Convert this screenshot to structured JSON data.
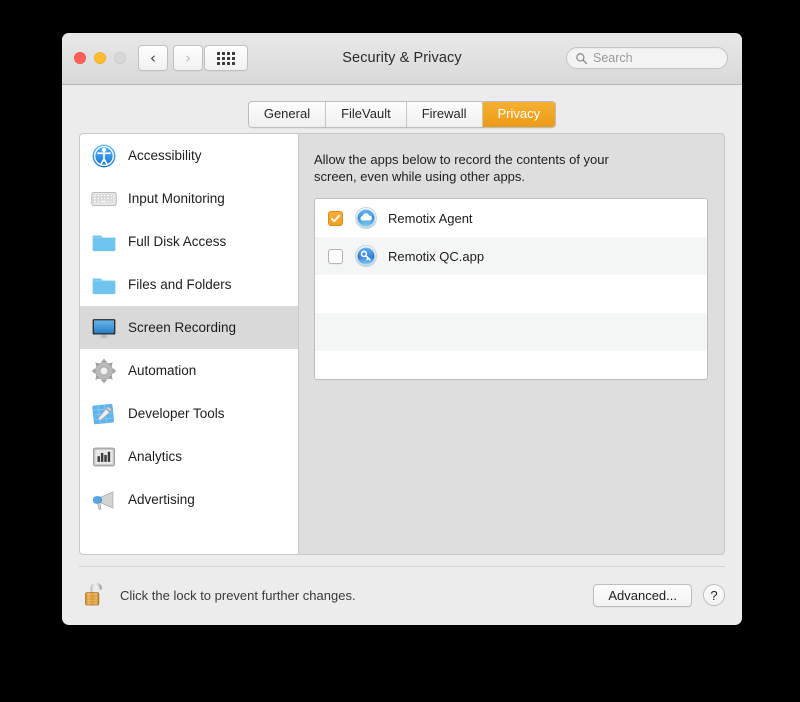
{
  "window": {
    "title": "Security & Privacy",
    "traffic_lights": [
      "close",
      "minimize",
      "zoom"
    ],
    "nav": {
      "back": "back-arrow",
      "forward": "forward-arrow",
      "grid": "show-all-grid"
    },
    "search": {
      "placeholder": "Search",
      "value": "",
      "icon": "search-icon"
    }
  },
  "tabs": [
    {
      "label": "General",
      "active": false
    },
    {
      "label": "FileVault",
      "active": false
    },
    {
      "label": "Firewall",
      "active": false
    },
    {
      "label": "Privacy",
      "active": true
    }
  ],
  "sidebar": {
    "items": [
      {
        "label": "Accessibility",
        "icon": "accessibility-icon",
        "selected": false
      },
      {
        "label": "Input Monitoring",
        "icon": "keyboard-icon",
        "selected": false
      },
      {
        "label": "Full Disk Access",
        "icon": "folder-icon",
        "selected": false
      },
      {
        "label": "Files and Folders",
        "icon": "folder-icon",
        "selected": false
      },
      {
        "label": "Screen Recording",
        "icon": "display-icon",
        "selected": true
      },
      {
        "label": "Automation",
        "icon": "gear-icon",
        "selected": false
      },
      {
        "label": "Developer Tools",
        "icon": "hammer-blueprint-icon",
        "selected": false
      },
      {
        "label": "Analytics",
        "icon": "bar-chart-icon",
        "selected": false
      },
      {
        "label": "Advertising",
        "icon": "megaphone-icon",
        "selected": false
      }
    ]
  },
  "detail": {
    "description": "Allow the apps below to record the contents of your screen, even while using other apps.",
    "apps": [
      {
        "name": "Remotix Agent",
        "checked": true,
        "icon": "cloud-badge-icon"
      },
      {
        "name": "Remotix QC.app",
        "checked": false,
        "icon": "key-badge-icon"
      }
    ],
    "empty_rows": 3
  },
  "footer": {
    "lock_icon": "unlocked-padlock-icon",
    "lock_text": "Click the lock to prevent further changes.",
    "advanced_label": "Advanced...",
    "help_label": "?"
  },
  "colors": {
    "accent_orange": "#eda022",
    "window_bg": "#ececec",
    "detail_bg": "#dedede",
    "selection_gray": "#d9d9d9"
  }
}
